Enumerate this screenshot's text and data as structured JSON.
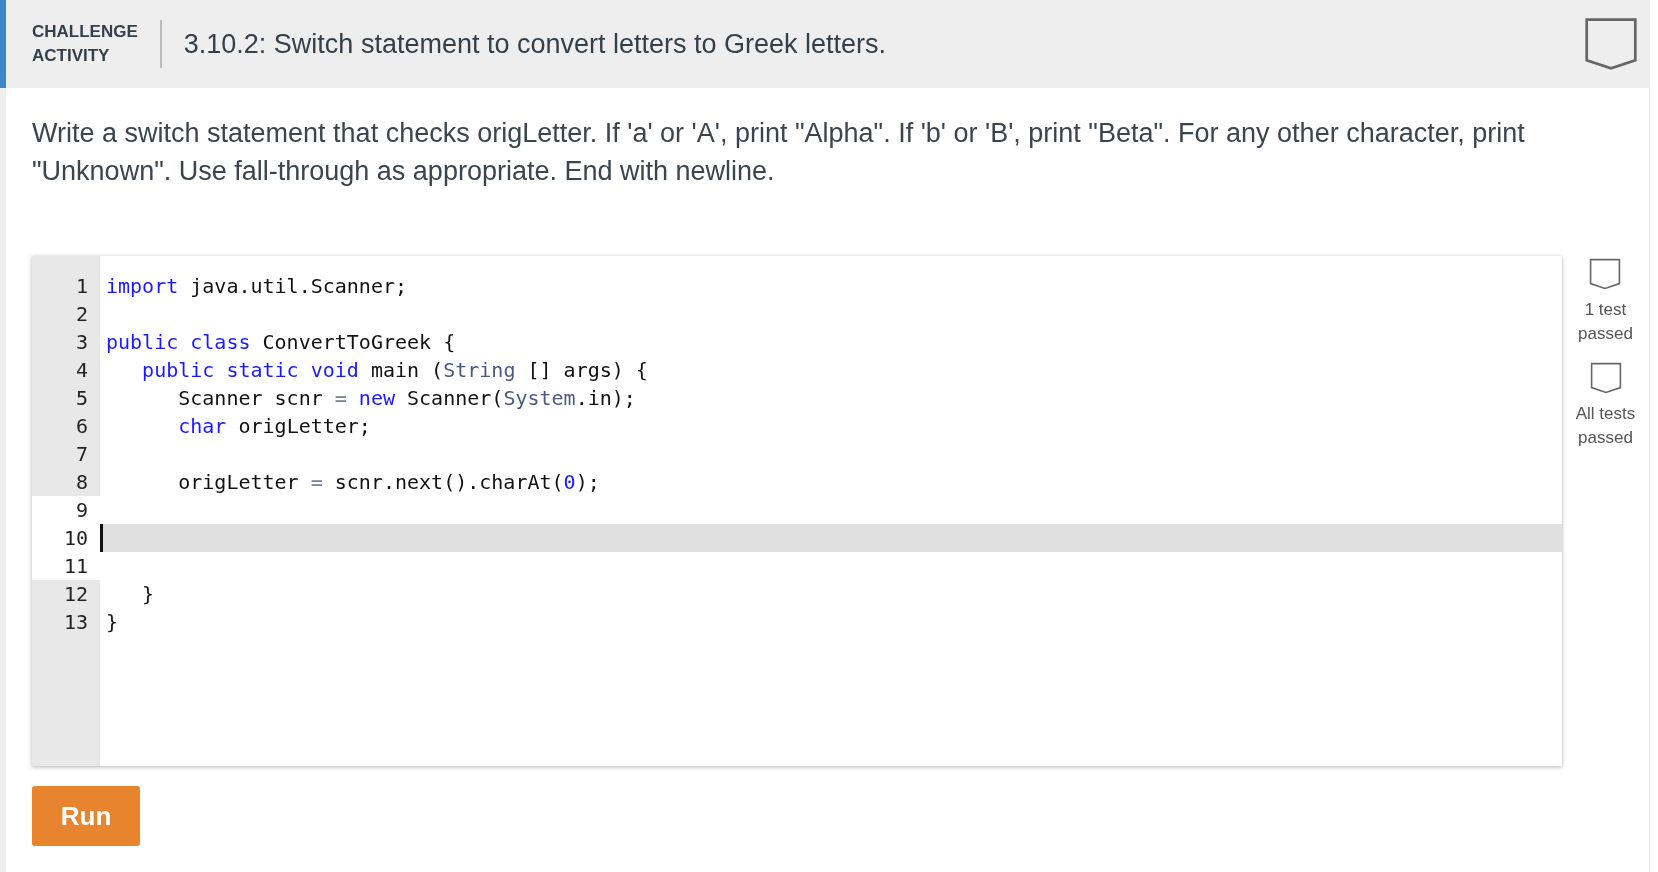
{
  "header": {
    "label_lines": [
      "CHALLENGE",
      "ACTIVITY"
    ],
    "title": "3.10.2: Switch statement to convert letters to Greek letters."
  },
  "description": "Write a switch statement that checks origLetter. If 'a' or 'A', print \"Alpha\". If 'b' or 'B', print \"Beta\". For any other character, print \"Unknown\". Use fall-through as appropriate. End with newline.",
  "editor": {
    "lines": [
      {
        "number": "1",
        "editable": false,
        "active": false,
        "tokens": [
          {
            "kind": "keyword",
            "text": "import"
          },
          {
            "kind": "plain",
            "text": " java.util.Scanner;"
          }
        ]
      },
      {
        "number": "2",
        "editable": false,
        "active": false
      },
      {
        "number": "3",
        "editable": false,
        "active": false,
        "tokens": [
          {
            "kind": "keyword",
            "text": "public class"
          },
          {
            "kind": "plain",
            "text": " ConvertToGreek {"
          }
        ]
      },
      {
        "number": "4",
        "editable": false,
        "active": false,
        "tokens": [
          {
            "kind": "keyword",
            "text": "   public static void"
          },
          {
            "kind": "plain",
            "text": " main ("
          },
          {
            "kind": "type",
            "text": "String"
          },
          {
            "kind": "plain",
            "text": " [] args) {"
          }
        ]
      },
      {
        "number": "5",
        "editable": false,
        "active": false,
        "tokens": [
          {
            "kind": "plain",
            "text": "      Scanner scnr "
          },
          {
            "kind": "operator",
            "text": "="
          },
          {
            "kind": "keyword",
            "text": " new"
          },
          {
            "kind": "plain",
            "text": " Scanner("
          },
          {
            "kind": "type",
            "text": "System"
          },
          {
            "kind": "plain",
            "text": ".in);"
          }
        ]
      },
      {
        "number": "6",
        "editable": false,
        "active": false,
        "tokens": [
          {
            "kind": "keyword",
            "text": "      char"
          },
          {
            "kind": "plain",
            "text": " origLetter;"
          }
        ]
      },
      {
        "number": "7",
        "editable": false,
        "active": false
      },
      {
        "number": "8",
        "editable": false,
        "active": false,
        "tokens": [
          {
            "kind": "plain",
            "text": "      origLetter "
          },
          {
            "kind": "operator",
            "text": "="
          },
          {
            "kind": "plain",
            "text": " scnr.next().charAt("
          },
          {
            "kind": "number",
            "text": "0"
          },
          {
            "kind": "plain",
            "text": ");"
          }
        ]
      },
      {
        "number": "9",
        "editable": true,
        "active": false
      },
      {
        "number": "10",
        "editable": true,
        "active": true
      },
      {
        "number": "11",
        "editable": true,
        "active": false
      },
      {
        "number": "12",
        "editable": false,
        "active": false,
        "tokens": [
          {
            "kind": "plain",
            "text": "   }"
          }
        ]
      },
      {
        "number": "13",
        "editable": false,
        "active": false,
        "tokens": [
          {
            "kind": "plain",
            "text": "}"
          }
        ]
      }
    ]
  },
  "tests": [
    {
      "label_lines": [
        "1 test",
        "passed"
      ]
    },
    {
      "label_lines": [
        "All tests",
        "passed"
      ]
    }
  ],
  "run_button": "Run"
}
